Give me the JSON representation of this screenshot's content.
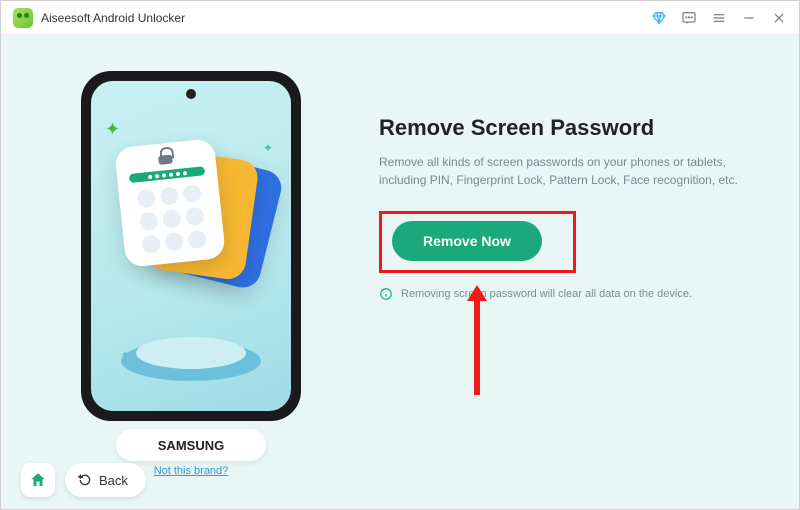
{
  "app": {
    "title": "Aiseesoft Android Unlocker"
  },
  "phone": {
    "brand": "SAMSUNG",
    "not_brand_link": "Not this brand?"
  },
  "nav": {
    "back": "Back"
  },
  "main": {
    "heading": "Remove Screen Password",
    "description": "Remove all kinds of screen passwords on your phones or tablets, including PIN, Fingerprint Lock, Pattern Lock, Face recognition, etc.",
    "cta": "Remove Now",
    "note": "Removing screen password will clear all data on the device."
  }
}
